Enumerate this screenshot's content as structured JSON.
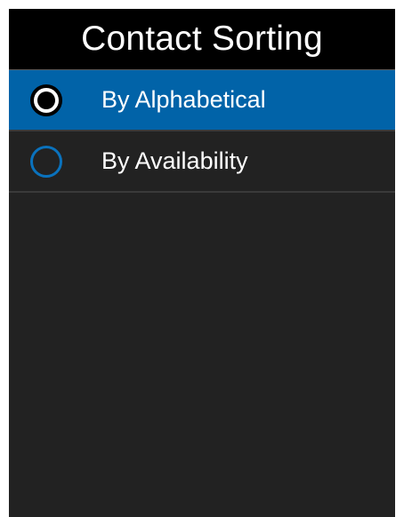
{
  "header": {
    "title": "Contact Sorting"
  },
  "options": [
    {
      "label": "By Alphabetical",
      "selected": true
    },
    {
      "label": "By Availability",
      "selected": false
    }
  ],
  "colors": {
    "accent": "#0163a8",
    "radio_ring": "#0a72bd",
    "background": "#222222",
    "title_background": "#000000"
  }
}
